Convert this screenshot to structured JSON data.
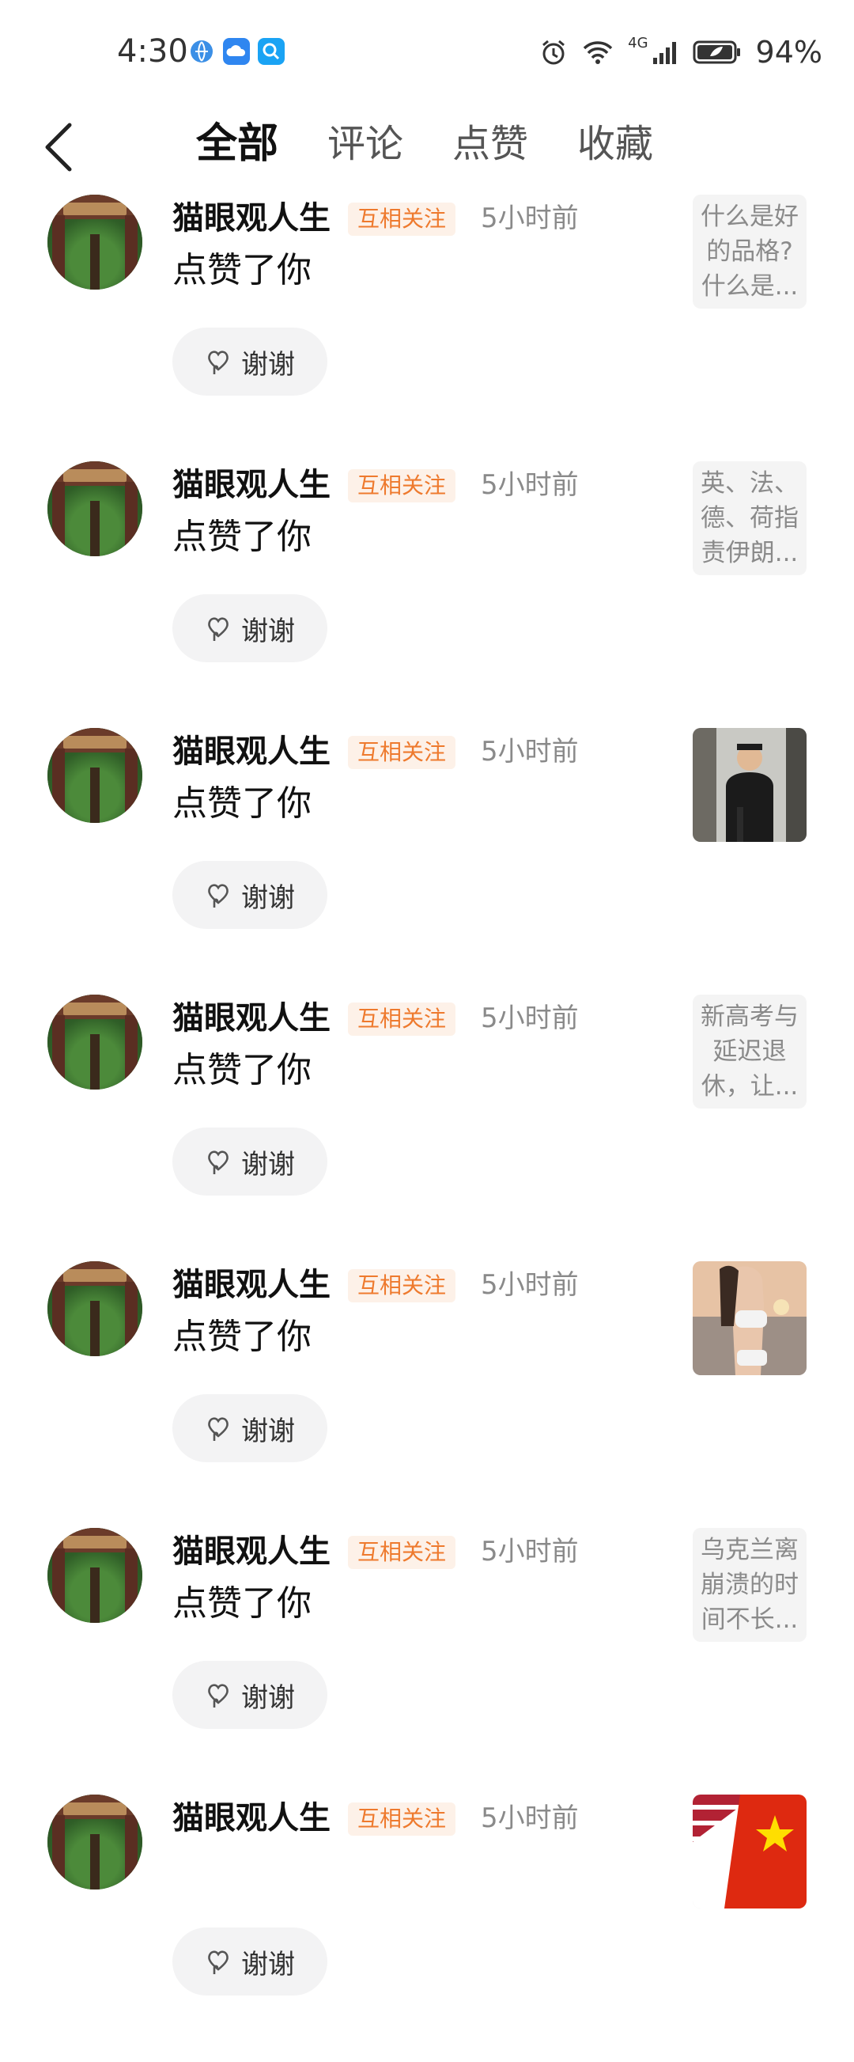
{
  "status_bar": {
    "time": "4:30",
    "battery": "94%",
    "network_label": "4G"
  },
  "nav": {
    "back_icon": "chevron-left-icon",
    "tabs": [
      {
        "label": "全部",
        "active": true
      },
      {
        "label": "评论",
        "active": false
      },
      {
        "label": "点赞",
        "active": false
      },
      {
        "label": "收藏",
        "active": false
      }
    ]
  },
  "thanks_label": "谢谢",
  "items": [
    {
      "user": "猫眼观人生",
      "tag": "互相关注",
      "time": "5小时前",
      "action": "点赞了你",
      "thumb_type": "text",
      "thumb_text": "什么是好的品格?什么是..."
    },
    {
      "user": "猫眼观人生",
      "tag": "互相关注",
      "time": "5小时前",
      "action": "点赞了你",
      "thumb_type": "text",
      "thumb_text": "英、法、德、荷指责伊朗..."
    },
    {
      "user": "猫眼观人生",
      "tag": "互相关注",
      "time": "5小时前",
      "action": "点赞了你",
      "thumb_type": "image",
      "thumb_desc": "man-photo"
    },
    {
      "user": "猫眼观人生",
      "tag": "互相关注",
      "time": "5小时前",
      "action": "点赞了你",
      "thumb_type": "text",
      "thumb_text": "新高考与延迟退休，让..."
    },
    {
      "user": "猫眼观人生",
      "tag": "互相关注",
      "time": "5小时前",
      "action": "点赞了你",
      "thumb_type": "image",
      "thumb_desc": "beach-photo"
    },
    {
      "user": "猫眼观人生",
      "tag": "互相关注",
      "time": "5小时前",
      "action": "点赞了你",
      "thumb_type": "text",
      "thumb_text": "乌克兰离崩溃的时间不长..."
    },
    {
      "user": "猫眼观人生",
      "tag": "互相关注",
      "time": "5小时前",
      "action": "",
      "thumb_type": "image",
      "thumb_desc": "flags-photo"
    }
  ],
  "colors": {
    "tag_bg": "#fdf1e8",
    "tag_text": "#ee7a2e",
    "muted": "#8a8a8a"
  }
}
